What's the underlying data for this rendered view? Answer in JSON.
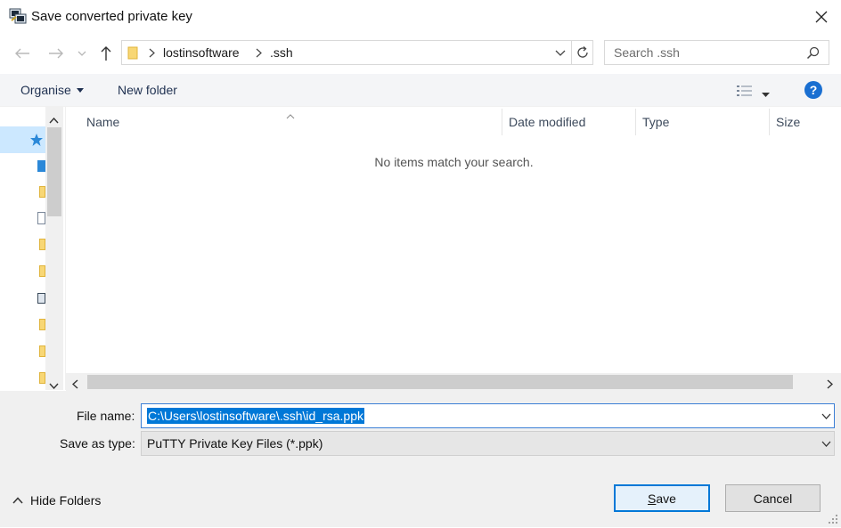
{
  "window": {
    "title": "Save converted private key"
  },
  "nav": {
    "breadcrumb": [
      "lostinsoftware",
      ".ssh"
    ],
    "search_placeholder": "Search .ssh"
  },
  "toolbar": {
    "organise_label": "Organise",
    "new_folder_label": "New folder"
  },
  "file_list": {
    "columns": [
      "Name",
      "Date modified",
      "Type",
      "Size"
    ],
    "empty_message": "No items match your search."
  },
  "form": {
    "file_name_label": "File name:",
    "file_name_value": "C:\\Users\\lostinsoftware\\.ssh\\id_rsa.ppk",
    "save_as_type_label": "Save as type:",
    "save_as_type_value": "PuTTY Private Key Files (*.ppk)"
  },
  "buttons": {
    "save": "Save",
    "cancel": "Cancel",
    "hide_folders": "Hide Folders"
  },
  "colors": {
    "accent": "#0078d7",
    "help": "#1a6fd1"
  }
}
